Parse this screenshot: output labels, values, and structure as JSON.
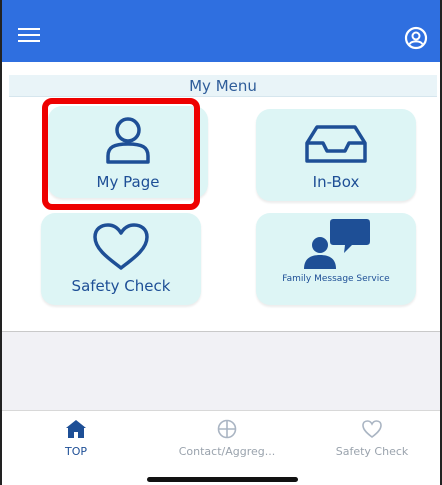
{
  "menu": {
    "title": "My Menu",
    "tiles": [
      {
        "label": "My Page",
        "icon": "person-icon"
      },
      {
        "label": "In-Box",
        "icon": "inbox-tray-icon"
      },
      {
        "label": "Safety Check",
        "icon": "heart-icon"
      },
      {
        "label": "Family Message Service",
        "icon": "person-speech-bubble-icon"
      }
    ]
  },
  "tab_bar": {
    "tabs": [
      {
        "label": "TOP",
        "icon": "home-icon",
        "active": true
      },
      {
        "label": "Contact/Aggreg...",
        "icon": "globe-circle-icon",
        "active": false
      },
      {
        "label": "Safety Check",
        "icon": "heart-outline-icon",
        "active": false
      }
    ]
  },
  "colors": {
    "app_bar": "#2f6fe0",
    "tile_bg": "#ddf5f5",
    "accent_text": "#1e4f96",
    "highlight": "#e00000"
  }
}
